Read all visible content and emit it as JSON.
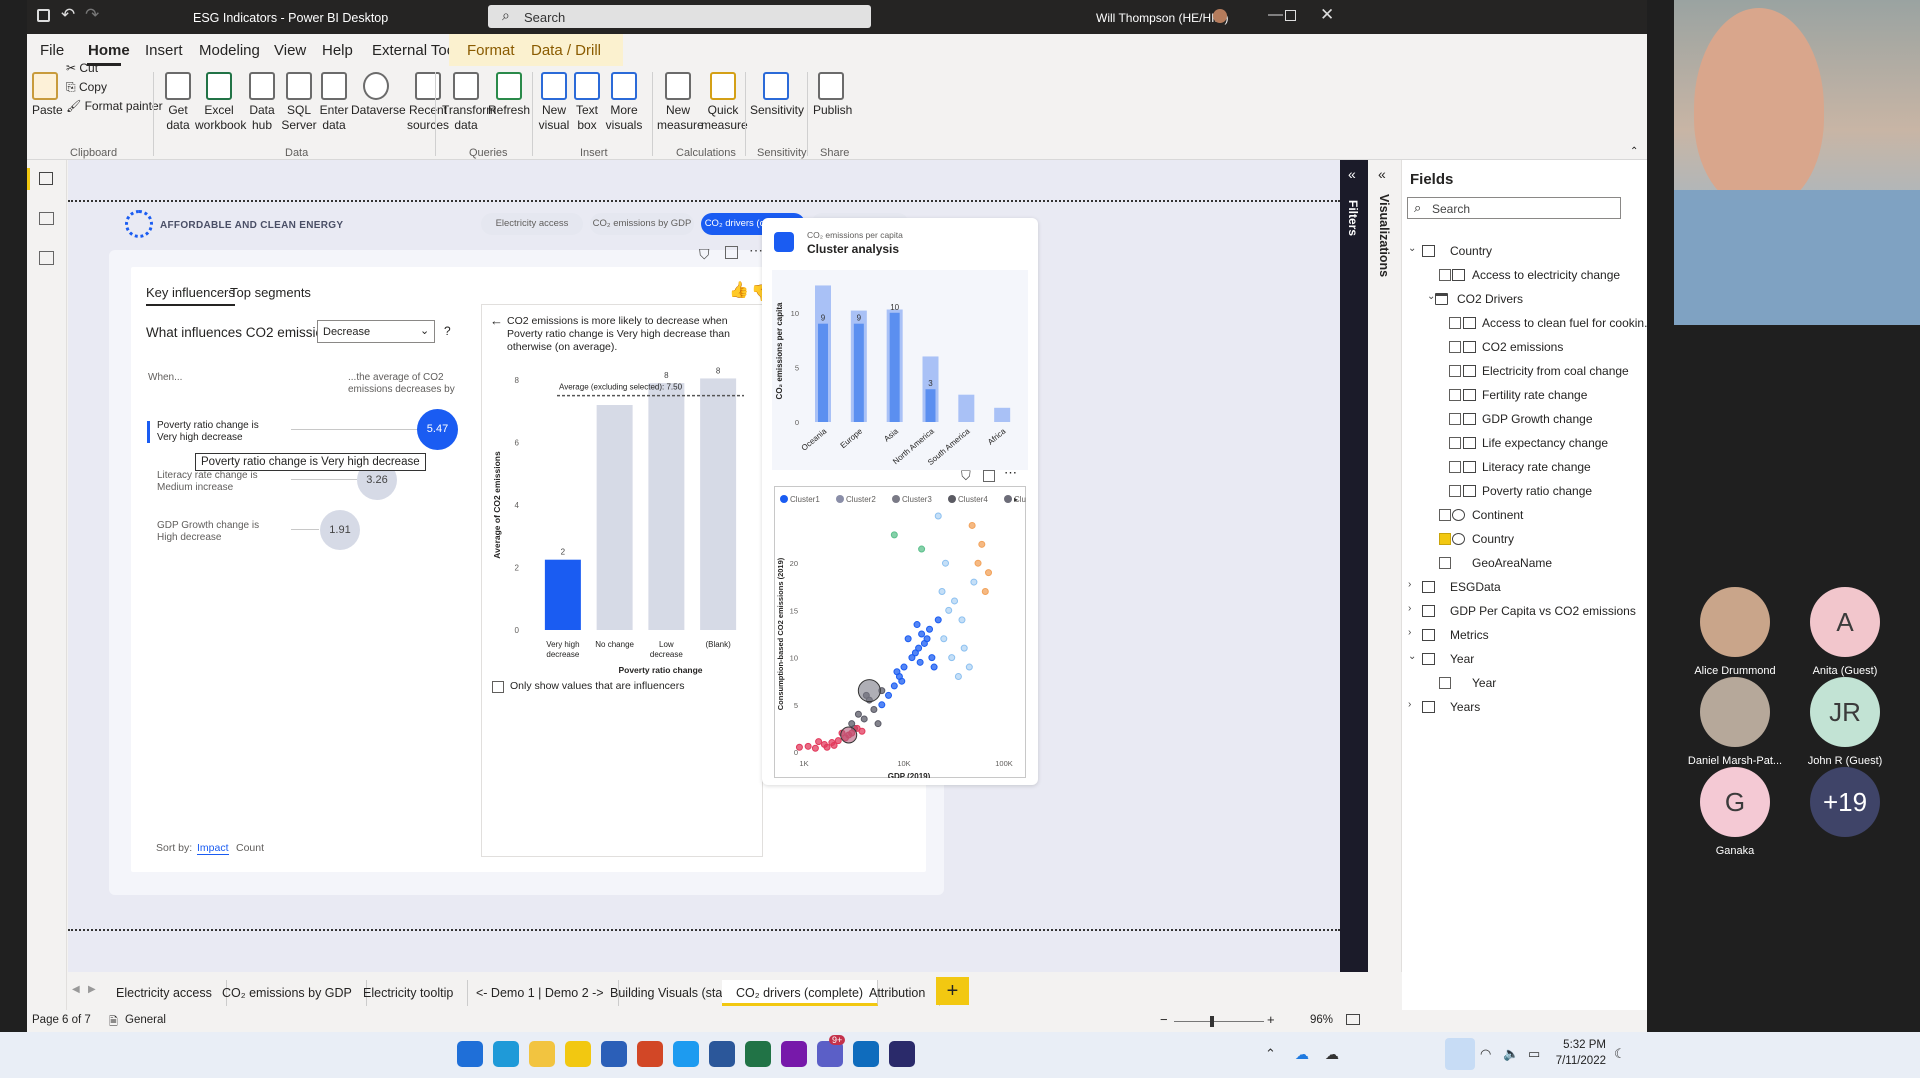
{
  "window": {
    "title": "ESG Indicators - Power BI Desktop",
    "search_placeholder": "Search",
    "user": "Will Thompson (HE/HIM)"
  },
  "ribbon_tabs": [
    "File",
    "Home",
    "Insert",
    "Modeling",
    "View",
    "Help",
    "External Tools",
    "Format",
    "Data / Drill"
  ],
  "ribbon": {
    "clipboard": {
      "paste": "Paste",
      "cut": "Cut",
      "copy": "Copy",
      "format_painter": "Format painter",
      "group": "Clipboard"
    },
    "data": {
      "get_data": "Get data",
      "excel": "Excel workbook",
      "data_hub": "Data hub",
      "sql": "SQL Server",
      "enter": "Enter data",
      "dataverse": "Dataverse",
      "recent": "Recent sources",
      "group": "Data"
    },
    "queries": {
      "transform": "Transform data",
      "refresh": "Refresh",
      "group": "Queries"
    },
    "insert": {
      "new_visual": "New visual",
      "text_box": "Text box",
      "more_visuals": "More visuals",
      "group": "Insert"
    },
    "calculations": {
      "new_measure": "New measure",
      "quick_measure": "Quick measure",
      "group": "Calculations"
    },
    "sensitivity": {
      "label": "Sensitivity",
      "group": "Sensitivity"
    },
    "share": {
      "publish": "Publish",
      "group": "Share"
    }
  },
  "report": {
    "brand": "AFFORDABLE AND CLEAN ENERGY",
    "nav_pills": [
      "Electricity access",
      "CO₂ emissions by GDP",
      "CO₂ drivers (complete)",
      "Attribution"
    ]
  },
  "key_influencers": {
    "tab_active": "Key influencers",
    "tab_other": "Top segments",
    "question": "What influences CO2 emissions to",
    "dropdown": "Decrease",
    "help": "?",
    "when": "When...",
    "avg_header": "...the average of CO2 emissions decreases by",
    "influencers": [
      {
        "label": "Poverty ratio change is Very high decrease",
        "value": "5.47"
      },
      {
        "label": "Literacy rate change is Medium increase",
        "value": "3.26"
      },
      {
        "label": "GDP Growth change is High decrease",
        "value": "1.91"
      }
    ],
    "tooltip": "Poverty ratio change is Very high decrease",
    "sort_by": "Sort by:",
    "sort_impact": "Impact",
    "sort_count": "Count",
    "detail_text": "CO2 emissions is more likely to decrease when Poverty ratio change is Very high decrease than otherwise (on average).",
    "only_show": "Only show values that are influencers"
  },
  "chart_data": [
    {
      "type": "bar",
      "title": "",
      "xlabel": "Poverty ratio change",
      "ylabel": "Average of CO2 emissions",
      "categories": [
        "Very high decrease",
        "No change",
        "Low decrease",
        "(Blank)"
      ],
      "values": [
        2.25,
        7.2,
        7.9,
        8.05
      ],
      "data_labels": [
        "2",
        "",
        "8",
        "8"
      ],
      "ylim": [
        0,
        8
      ],
      "yticks": [
        0,
        2,
        4,
        6,
        8
      ],
      "reference_line": {
        "label": "Average (excluding selected): 7.50",
        "value": 7.5
      },
      "highlight_color": "#1a5cf2",
      "other_color": "#d6dae6"
    },
    {
      "type": "bar",
      "subtitle": "CO₂ emissions per capita",
      "title": "Cluster analysis",
      "ylabel": "CO₂ emissions per capita",
      "categories": [
        "Oceania",
        "Europe",
        "Asia",
        "North America",
        "South America",
        "Africa"
      ],
      "series": [
        {
          "values": [
            12.5,
            10.2,
            10.3,
            6,
            2.5,
            1.3
          ]
        },
        {
          "values": [
            9,
            9,
            10,
            3,
            0,
            0
          ]
        }
      ],
      "data_labels": [
        "9",
        "9",
        "10",
        "3",
        "",
        ""
      ],
      "ylim": [
        0,
        13
      ],
      "yticks": [
        0,
        5,
        10
      ]
    },
    {
      "type": "scatter",
      "xlabel": "GDP (2019)",
      "ylabel": "Consumption-based CO2 emissions (2019)",
      "xscale": "log",
      "xticks": [
        "1K",
        "10K",
        "100K"
      ],
      "yticks": [
        0,
        5,
        10,
        15,
        20
      ],
      "legend": [
        "Cluster1",
        "Cluster2",
        "Cluster3",
        "Cluster4",
        "Cluster5"
      ],
      "legend_colors": [
        "#1a5cf2",
        "#8a8ea8",
        "#7a7a86",
        "#5a5a62",
        "#6c6c78"
      ],
      "series": [
        {
          "name": "Cluster1",
          "color": "#1a5cf2",
          "points": [
            [
              6000,
              5
            ],
            [
              7000,
              6
            ],
            [
              8000,
              7
            ],
            [
              9000,
              8
            ],
            [
              10000,
              9
            ],
            [
              12000,
              10
            ],
            [
              14000,
              11
            ],
            [
              11000,
              12
            ],
            [
              13000,
              10.5
            ],
            [
              15000,
              12.5
            ],
            [
              9500,
              7.5
            ],
            [
              16000,
              11.5
            ],
            [
              18000,
              13
            ],
            [
              20000,
              9
            ],
            [
              8500,
              8.5
            ],
            [
              17000,
              12
            ],
            [
              19000,
              10
            ],
            [
              22000,
              14
            ],
            [
              14500,
              9.5
            ],
            [
              13500,
              13.5
            ]
          ]
        },
        {
          "name": "Cluster2",
          "color": "#5a5a66",
          "points": [
            [
              3000,
              3
            ],
            [
              3500,
              4
            ],
            [
              4000,
              3.5
            ],
            [
              5000,
              4.5
            ],
            [
              4500,
              5.5
            ],
            [
              6000,
              6.5
            ],
            [
              3200,
              2.5
            ],
            [
              5500,
              3
            ],
            [
              4200,
              6
            ]
          ]
        },
        {
          "name": "Cluster3",
          "color": "#e23a5c",
          "points": [
            [
              900,
              0.5
            ],
            [
              1100,
              0.6
            ],
            [
              1300,
              0.4
            ],
            [
              1600,
              0.8
            ],
            [
              1900,
              1
            ],
            [
              2200,
              1.2
            ],
            [
              2600,
              1.5
            ],
            [
              3000,
              2
            ],
            [
              3400,
              2.5
            ],
            [
              1400,
              1.1
            ],
            [
              2000,
              0.7
            ],
            [
              2400,
              2
            ],
            [
              2800,
              1.8
            ],
            [
              1700,
              0.5
            ],
            [
              3800,
              2.2
            ]
          ]
        },
        {
          "name": "Cluster4",
          "color": "#8cc0f0",
          "points": [
            [
              25000,
              12
            ],
            [
              30000,
              10
            ],
            [
              28000,
              15
            ],
            [
              35000,
              8
            ],
            [
              24000,
              17
            ],
            [
              26000,
              20
            ],
            [
              22000,
              25
            ],
            [
              32000,
              16
            ],
            [
              40000,
              11
            ],
            [
              45000,
              9
            ],
            [
              38000,
              14
            ],
            [
              50000,
              18
            ]
          ]
        },
        {
          "name": "Cluster5",
          "color": "#f2a25a",
          "points": [
            [
              60000,
              22
            ],
            [
              70000,
              19
            ],
            [
              55000,
              20
            ],
            [
              48000,
              24
            ],
            [
              65000,
              17
            ]
          ]
        },
        {
          "name": "Other",
          "color": "#5cc08c",
          "points": [
            [
              8000,
              23
            ],
            [
              15000,
              21.5
            ]
          ]
        }
      ]
    }
  ],
  "fields": {
    "title": "Fields",
    "search_placeholder": "Search",
    "items": [
      {
        "label": "Country",
        "kind": "table"
      },
      {
        "label": "Access to electricity change",
        "kind": "measure"
      },
      {
        "label": "CO2 Drivers",
        "kind": "folder"
      },
      {
        "label": "Access to clean fuel for cookin...",
        "kind": "measure"
      },
      {
        "label": "CO2 emissions",
        "kind": "calc"
      },
      {
        "label": "Electricity from coal change",
        "kind": "measure"
      },
      {
        "label": "Fertility rate change",
        "kind": "measure"
      },
      {
        "label": "GDP Growth change",
        "kind": "measure"
      },
      {
        "label": "Life expectancy change",
        "kind": "measure"
      },
      {
        "label": "Literacy rate change",
        "kind": "measure"
      },
      {
        "label": "Poverty ratio change",
        "kind": "measure"
      },
      {
        "label": "Continent",
        "kind": "globe"
      },
      {
        "label": "Country",
        "kind": "globe"
      },
      {
        "label": "GeoAreaName",
        "kind": "plain"
      },
      {
        "label": "ESGData",
        "kind": "table"
      },
      {
        "label": "GDP Per Capita vs CO2 emissions",
        "kind": "table"
      },
      {
        "label": "Metrics",
        "kind": "table"
      },
      {
        "label": "Year",
        "kind": "table"
      },
      {
        "label": "Year",
        "kind": "plain"
      },
      {
        "label": "Years",
        "kind": "table"
      }
    ]
  },
  "side_panes": {
    "filters": "Filters",
    "visualizations": "Visualizations"
  },
  "page_tabs": [
    "Electricity access",
    "CO₂ emissions by GDP",
    "Electricity tooltip",
    "<- Demo 1 | Demo 2 ->",
    "Building Visuals (start)",
    "CO₂ drivers (complete)",
    "Attribution"
  ],
  "add_page": "+",
  "status": {
    "page": "Page 6 of 7",
    "sensitivity": "General",
    "zoom": "96%"
  },
  "taskbar": {
    "time": "5:32 PM",
    "date": "7/11/2022",
    "teams_badge": "9+"
  },
  "participants": [
    {
      "name": "Alice Drummond",
      "initial": "",
      "color": "#c9a58a"
    },
    {
      "name": "Anita (Guest)",
      "initial": "A",
      "color": "#f2c6cc"
    },
    {
      "name": "Daniel Marsh-Pat...",
      "initial": "",
      "color": "#b6a89a"
    },
    {
      "name": "John R (Guest)",
      "initial": "JR",
      "color": "#c2e3d4"
    },
    {
      "name": "Ganaka",
      "initial": "G",
      "color": "#f4c9d4"
    },
    {
      "name": "",
      "initial": "+19",
      "color": "#3f4468"
    }
  ]
}
